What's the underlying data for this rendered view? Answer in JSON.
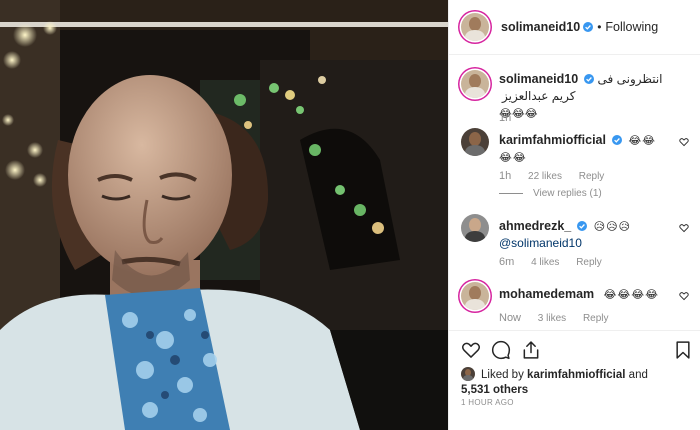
{
  "post": {
    "image_alt": "video still of bald man in white jacket and floral shirt",
    "author": "solimaneid10",
    "follow_status": "Following",
    "separator": "•"
  },
  "caption": {
    "username": "solimaneid10",
    "text": "انتظرونى فى كريم عبدالعزيز",
    "emoji": "😂😂😂",
    "time": "1h"
  },
  "comments": [
    {
      "username": "karimfahmiofficial",
      "text": "😂😂😂😂",
      "time": "1h",
      "likes": "22 likes",
      "reply": "Reply",
      "view_replies": "View replies (1)"
    },
    {
      "username": "ahmedrezk_",
      "emoji": "😥😥😥",
      "mention": "@solimaneid10",
      "time": "6m",
      "likes": "4 likes",
      "reply": "Reply"
    },
    {
      "username": "mohamedemam",
      "text": "😂😂😂😂",
      "time": "Now",
      "likes": "3 likes",
      "reply": "Reply"
    }
  ],
  "likes": {
    "prefix": "Liked by",
    "user": "karimfahmiofficial",
    "and": "and",
    "count": "5,531 others"
  },
  "timestamp": "1 HOUR AGO",
  "icons": [
    "heart-icon",
    "comment-icon",
    "share-icon",
    "bookmark-icon",
    "verified-icon",
    "small-heart-icon"
  ],
  "colors": {
    "verified": "#3897f0",
    "mention": "#003569",
    "muted": "#8e8e8e",
    "text": "#262626"
  }
}
